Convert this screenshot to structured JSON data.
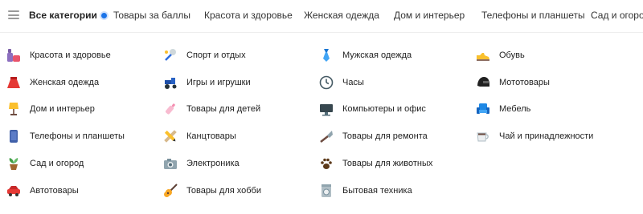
{
  "topnav": {
    "all_categories": "Все категории",
    "links": [
      "Товары за баллы",
      "Красота и здоровье",
      "Женская одежда",
      "Дом и интерьер",
      "Телефоны и планшеты",
      "Сад и огород"
    ]
  },
  "categories": {
    "col1": [
      {
        "label": "Красота и здоровье",
        "icon": "cosmetics-icon"
      },
      {
        "label": "Женская одежда",
        "icon": "skirt-icon"
      },
      {
        "label": "Дом и интерьер",
        "icon": "lamp-icon"
      },
      {
        "label": "Телефоны и планшеты",
        "icon": "phone-icon"
      },
      {
        "label": "Сад и огород",
        "icon": "plant-icon"
      },
      {
        "label": "Автотовары",
        "icon": "car-icon"
      }
    ],
    "col2": [
      {
        "label": "Спорт и отдых",
        "icon": "badminton-icon"
      },
      {
        "label": "Игры и игрушки",
        "icon": "toy-tractor-icon"
      },
      {
        "label": "Товары для детей",
        "icon": "baby-bottle-icon"
      },
      {
        "label": "Канцтовары",
        "icon": "pencil-ruler-icon"
      },
      {
        "label": "Электроника",
        "icon": "camera-icon"
      },
      {
        "label": "Товары для хобби",
        "icon": "guitar-icon"
      }
    ],
    "col3": [
      {
        "label": "Мужская одежда",
        "icon": "tie-icon"
      },
      {
        "label": "Часы",
        "icon": "clock-icon"
      },
      {
        "label": "Компьютеры и офис",
        "icon": "monitor-icon"
      },
      {
        "label": "Товары для ремонта",
        "icon": "trowel-icon"
      },
      {
        "label": "Товары для животных",
        "icon": "paw-icon"
      },
      {
        "label": "Бытовая техника",
        "icon": "washing-machine-icon"
      }
    ],
    "col4": [
      {
        "label": "Обувь",
        "icon": "shoe-icon"
      },
      {
        "label": "Мототовары",
        "icon": "helmet-icon"
      },
      {
        "label": "Мебель",
        "icon": "armchair-icon"
      },
      {
        "label": "Чай и принадлежности",
        "icon": "cup-icon"
      }
    ]
  }
}
